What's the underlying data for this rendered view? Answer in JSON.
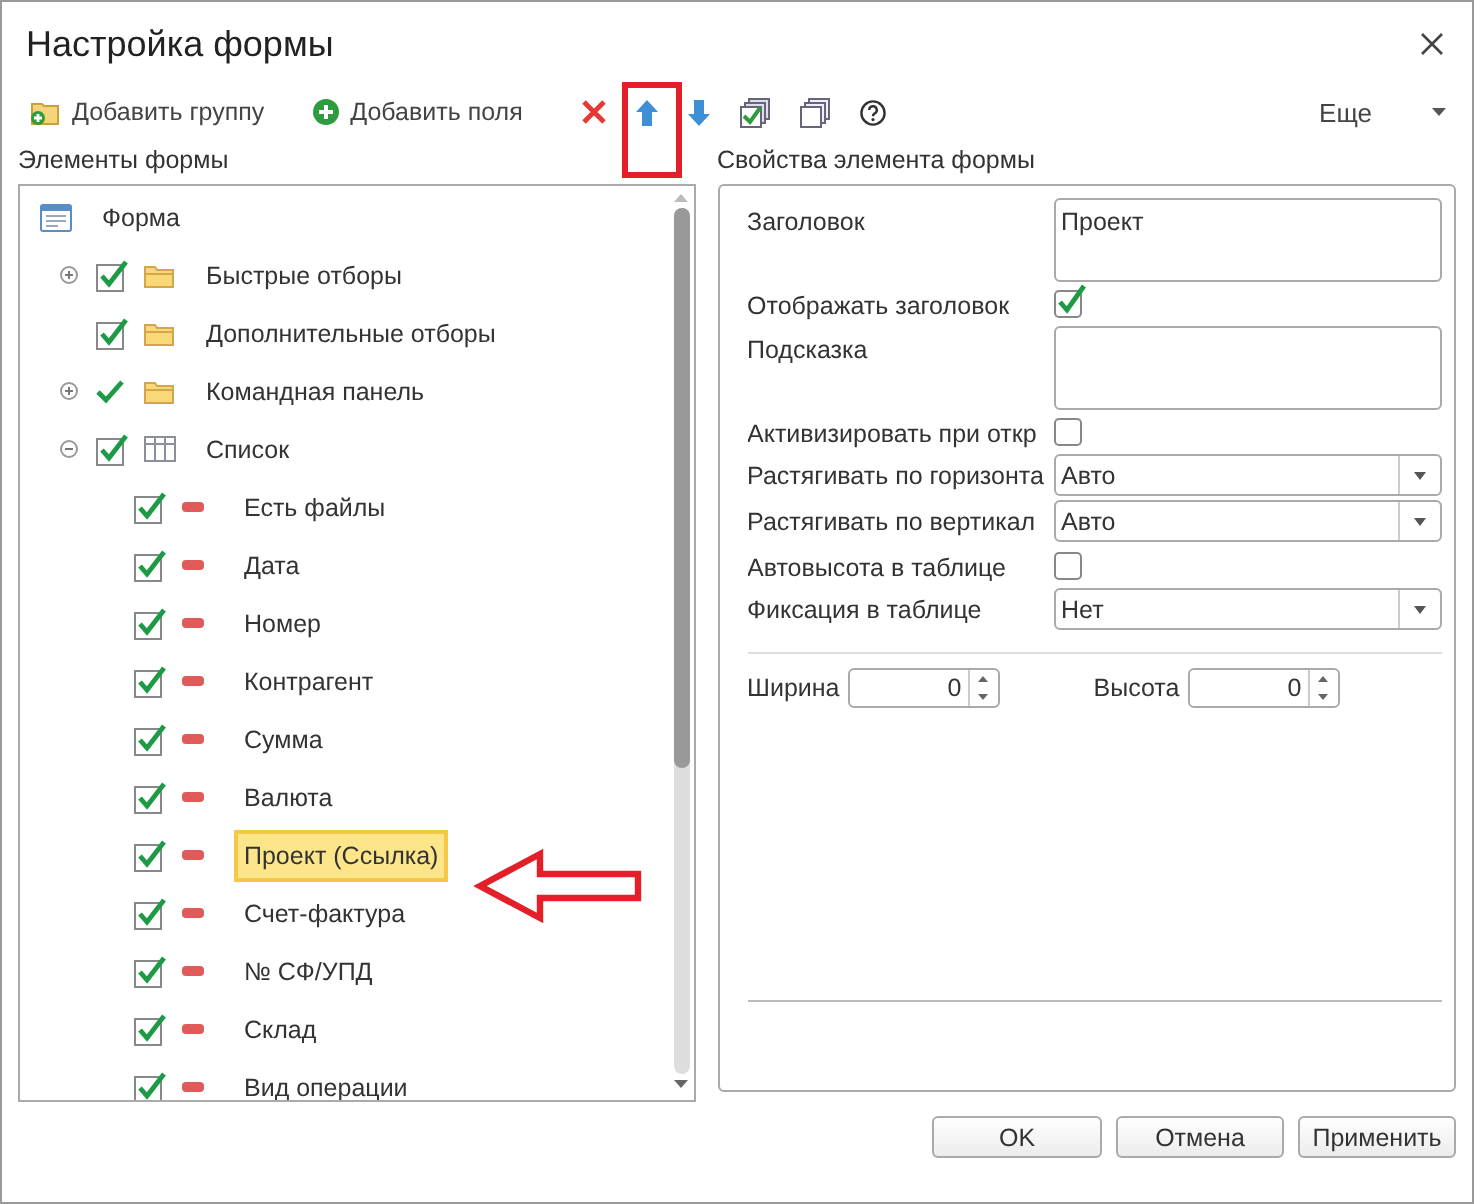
{
  "window": {
    "title": "Настройка формы"
  },
  "toolbar": [
    {
      "kind": "add_group",
      "label": "Добавить группу"
    },
    {
      "kind": "add_field",
      "label": "Добавить поля"
    },
    {
      "kind": "delete"
    },
    {
      "kind": "up"
    },
    {
      "kind": "down"
    },
    {
      "kind": "check_all"
    },
    {
      "kind": "uncheck_all"
    },
    {
      "kind": "help"
    }
  ],
  "more": "Еще",
  "left_panel": {
    "title": "Элементы формы",
    "tree": [
      {
        "label": "Форма",
        "kind": "form",
        "selected": false,
        "children": [
          {
            "label": "Быстрые отборы",
            "kind": "folder",
            "checked": true,
            "expanded": false,
            "selected": false
          },
          {
            "label": "Дополнительные отборы",
            "kind": "folder",
            "checked": true,
            "selected": false
          },
          {
            "label": "Командная панель",
            "kind": "panel",
            "checked": true,
            "expanded": false,
            "selected": false
          },
          {
            "label": "Список",
            "kind": "table",
            "checked": true,
            "expanded": true,
            "selected": false,
            "children": [
              {
                "label": "Есть файлы",
                "kind": "field",
                "checked": true,
                "selected": false
              },
              {
                "label": "Дата",
                "kind": "field",
                "checked": true,
                "selected": false
              },
              {
                "label": "Номер",
                "kind": "field",
                "checked": true,
                "selected": false
              },
              {
                "label": "Контрагент",
                "kind": "field",
                "checked": true,
                "selected": false
              },
              {
                "label": "Сумма",
                "kind": "field",
                "checked": true,
                "selected": false
              },
              {
                "label": "Валюта",
                "kind": "field",
                "checked": true,
                "selected": false
              },
              {
                "label": "Проект (Ссылка)",
                "kind": "field",
                "checked": true,
                "selected": true
              },
              {
                "label": "Счет-фактура",
                "kind": "field",
                "checked": true,
                "selected": false
              },
              {
                "label": "№ СФ/УПД",
                "kind": "field",
                "checked": true,
                "selected": false
              },
              {
                "label": "Склад",
                "kind": "field",
                "checked": true,
                "selected": false
              },
              {
                "label": "Вид операции",
                "kind": "field",
                "checked": true,
                "selected": false
              }
            ]
          }
        ]
      }
    ]
  },
  "right_panel": {
    "title": "Свойства элемента формы",
    "properties": [
      {
        "kind": "text",
        "label": "Заголовок",
        "value": "Проект"
      },
      {
        "kind": "check",
        "label": "Отображать заголовок",
        "checked": true
      },
      {
        "kind": "text",
        "label": "Подсказка"
      },
      {
        "kind": "check",
        "label": "Активизировать при откр",
        "checked": false
      },
      {
        "kind": "select",
        "label": "Растягивать по горизонта",
        "value": "Авто"
      },
      {
        "kind": "select",
        "label": "Растягивать по вертикал",
        "value": "Авто"
      },
      {
        "kind": "check",
        "label": "Автовысота в таблице",
        "checked": false
      },
      {
        "kind": "select",
        "label": "Фиксация в таблице",
        "value": "Нет"
      }
    ],
    "size": [
      {
        "label": "Ширина",
        "value": "0"
      },
      {
        "label": "Высота",
        "value": "0"
      }
    ]
  },
  "buttons": [
    "OK",
    "Отмена",
    "Применить"
  ]
}
